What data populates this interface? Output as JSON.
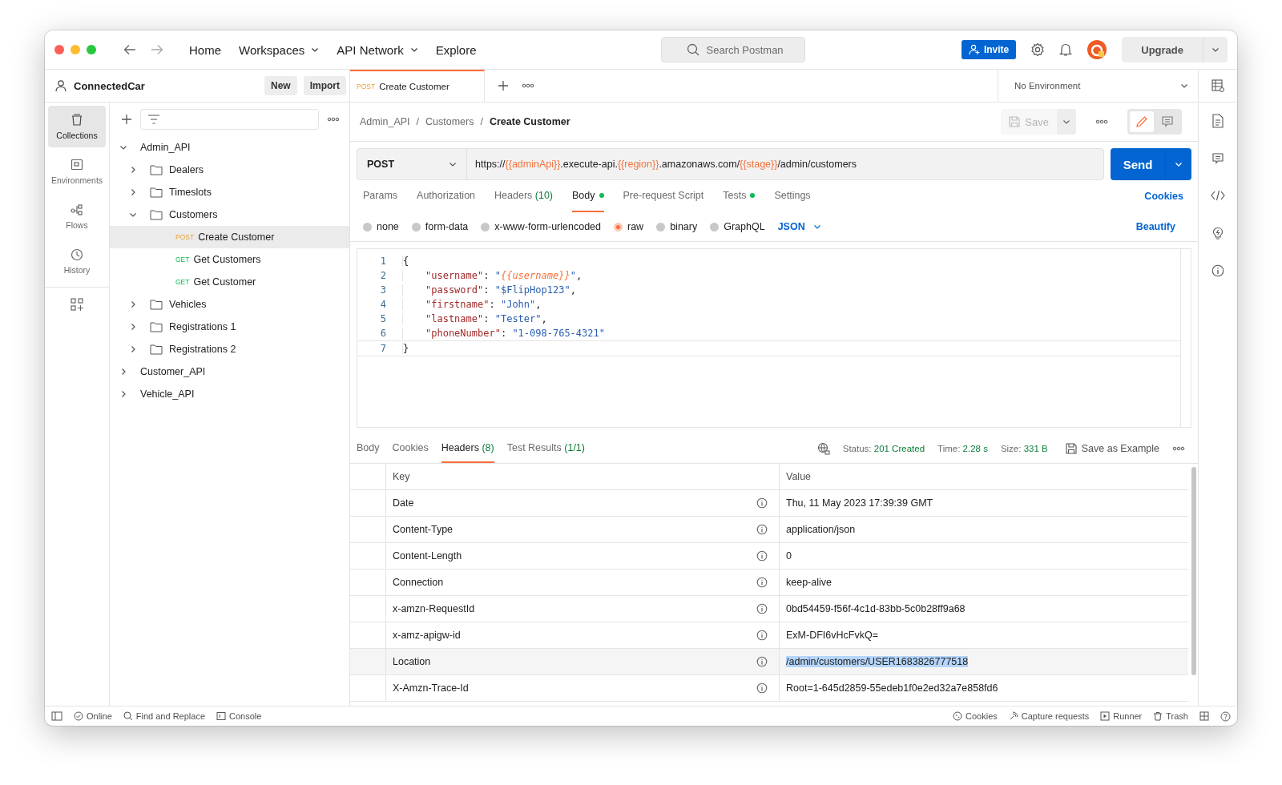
{
  "topbar": {
    "nav": [
      {
        "label": "Home",
        "dropdown": false
      },
      {
        "label": "Workspaces",
        "dropdown": true
      },
      {
        "label": "API Network",
        "dropdown": true
      },
      {
        "label": "Explore",
        "dropdown": false
      }
    ],
    "search": {
      "placeholder": "Search Postman"
    },
    "invite": "Invite",
    "upgrade": "Upgrade"
  },
  "workspace": {
    "name": "ConnectedCar",
    "buttons": [
      "New",
      "Import"
    ]
  },
  "rail": [
    {
      "label": "Collections",
      "selected": true
    },
    {
      "label": "Environments",
      "selected": false
    },
    {
      "label": "Flows",
      "selected": false
    },
    {
      "label": "History",
      "selected": false
    }
  ],
  "tree": [
    {
      "kind": "collection",
      "label": "Admin_API",
      "expanded": true,
      "children": [
        {
          "kind": "folder",
          "label": "Dealers",
          "expanded": false
        },
        {
          "kind": "folder",
          "label": "Timeslots",
          "expanded": false
        },
        {
          "kind": "folder",
          "label": "Customers",
          "expanded": true,
          "children": [
            {
              "kind": "request",
              "method": "POST",
              "label": "Create Customer",
              "selected": true
            },
            {
              "kind": "request",
              "method": "GET",
              "label": "Get Customers",
              "selected": false
            },
            {
              "kind": "request",
              "method": "GET",
              "label": "Get Customer",
              "selected": false
            }
          ]
        },
        {
          "kind": "folder",
          "label": "Vehicles",
          "expanded": false
        },
        {
          "kind": "folder",
          "label": "Registrations 1",
          "expanded": false
        },
        {
          "kind": "folder",
          "label": "Registrations 2",
          "expanded": false
        }
      ]
    },
    {
      "kind": "collection",
      "label": "Customer_API",
      "expanded": false
    },
    {
      "kind": "collection",
      "label": "Vehicle_API",
      "expanded": false
    }
  ],
  "tabs": [
    {
      "method": "POST",
      "title": "Create Customer",
      "selected": true
    }
  ],
  "environment": "No Environment",
  "breadcrumb": [
    "Admin_API",
    "/",
    "Customers",
    "/",
    "Create Customer"
  ],
  "save": "Save",
  "request": {
    "method": "POST",
    "url": [
      {
        "text": "https://",
        "variable": false
      },
      {
        "text": "{{adminApi}}",
        "variable": true
      },
      {
        "text": ".execute-api.",
        "variable": false
      },
      {
        "text": "{{region}}",
        "variable": true
      },
      {
        "text": ".amazonaws.com/",
        "variable": false
      },
      {
        "text": "{{stage}}",
        "variable": true
      },
      {
        "text": "/admin/customers",
        "variable": false
      }
    ],
    "send": "Send"
  },
  "request_tabs": [
    {
      "label": "Params",
      "dot": false,
      "selected": false
    },
    {
      "label": "Authorization",
      "dot": false,
      "selected": false
    },
    {
      "label": "Headers",
      "count": "(10)",
      "dot": false,
      "selected": false
    },
    {
      "label": "Body",
      "dot": true,
      "selected": true
    },
    {
      "label": "Pre-request Script",
      "dot": false,
      "selected": false
    },
    {
      "label": "Tests",
      "dot": true,
      "selected": false
    },
    {
      "label": "Settings",
      "dot": false,
      "selected": false
    }
  ],
  "cookies_link": "Cookies",
  "body_types": [
    {
      "label": "none",
      "selected": false
    },
    {
      "label": "form-data",
      "selected": false
    },
    {
      "label": "x-www-form-urlencoded",
      "selected": false
    },
    {
      "label": "raw",
      "selected": true
    },
    {
      "label": "binary",
      "selected": false
    },
    {
      "label": "GraphQL",
      "selected": false
    }
  ],
  "format": "JSON",
  "beautify": "Beautify",
  "code": [
    {
      "number": "1",
      "tokens": [
        {
          "text": "{",
          "kind": "punct"
        }
      ]
    },
    {
      "number": "2",
      "tokens": [
        {
          "text": "\"username\"",
          "kind": "key"
        },
        {
          "text": ": ",
          "kind": "punct"
        },
        {
          "text": "\"",
          "kind": "string"
        },
        {
          "text": "{{username}}",
          "kind": "variable"
        },
        {
          "text": "\"",
          "kind": "string"
        },
        {
          "text": ",",
          "kind": "punct"
        }
      ]
    },
    {
      "number": "3",
      "tokens": [
        {
          "text": "\"password\"",
          "kind": "key"
        },
        {
          "text": ": ",
          "kind": "punct"
        },
        {
          "text": "\"$FlipHop123\"",
          "kind": "string"
        },
        {
          "text": ",",
          "kind": "punct"
        }
      ]
    },
    {
      "number": "4",
      "tokens": [
        {
          "text": "\"firstname\"",
          "kind": "key"
        },
        {
          "text": ": ",
          "kind": "punct"
        },
        {
          "text": "\"John\"",
          "kind": "string"
        },
        {
          "text": ",",
          "kind": "punct"
        }
      ]
    },
    {
      "number": "5",
      "tokens": [
        {
          "text": "\"lastname\"",
          "kind": "key"
        },
        {
          "text": ": ",
          "kind": "punct"
        },
        {
          "text": "\"Tester\"",
          "kind": "string"
        },
        {
          "text": ",",
          "kind": "punct"
        }
      ]
    },
    {
      "number": "6",
      "tokens": [
        {
          "text": "\"phoneNumber\"",
          "kind": "key"
        },
        {
          "text": ": ",
          "kind": "punct"
        },
        {
          "text": "\"1-098-765-4321\"",
          "kind": "string"
        }
      ]
    },
    {
      "number": "7",
      "tokens": [
        {
          "text": "}",
          "kind": "punct"
        }
      ]
    }
  ],
  "response_tabs": [
    {
      "label": "Body",
      "selected": false
    },
    {
      "label": "Cookies",
      "selected": false
    },
    {
      "label": "Headers",
      "count": "(8)",
      "selected": true
    },
    {
      "label": "Test Results",
      "count": "(1/1)",
      "selected": false
    }
  ],
  "response_meta": [
    {
      "label": "Status:",
      "value": "201 Created"
    },
    {
      "label": "Time:",
      "value": "2.28 s"
    },
    {
      "label": "Size:",
      "value": "331 B"
    }
  ],
  "save_example": "Save as Example",
  "headers_table": {
    "columns": [
      "Key",
      "Value"
    ],
    "rows": [
      {
        "key": "Date",
        "value": "Thu, 11 May 2023 17:39:39 GMT",
        "selected": false
      },
      {
        "key": "Content-Type",
        "value": "application/json",
        "selected": false
      },
      {
        "key": "Content-Length",
        "value": "0",
        "selected": false
      },
      {
        "key": "Connection",
        "value": "keep-alive",
        "selected": false
      },
      {
        "key": "x-amzn-RequestId",
        "value": "0bd54459-f56f-4c1d-83bb-5c0b28ff9a68",
        "selected": false
      },
      {
        "key": "x-amz-apigw-id",
        "value": "ExM-DFI6vHcFvkQ=",
        "selected": false
      },
      {
        "key": "Location",
        "value": "/admin/customers/USER1683826777518",
        "selected": true
      },
      {
        "key": "X-Amzn-Trace-Id",
        "value": "Root=1-645d2859-55edeb1f0e2ed32a7e858fd6",
        "selected": false
      }
    ]
  },
  "status_bar": {
    "left": [
      "Online",
      "Find and Replace",
      "Console"
    ],
    "right": [
      "Cookies",
      "Capture requests",
      "Runner",
      "Trash"
    ]
  }
}
